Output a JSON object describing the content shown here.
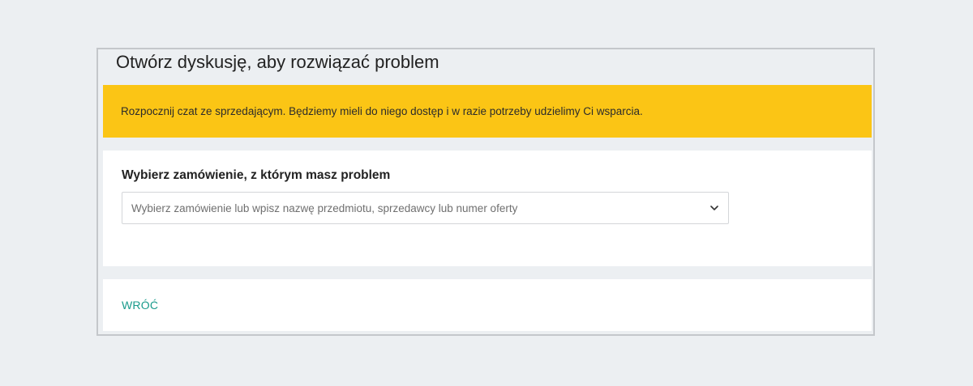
{
  "header": {
    "title": "Otwórz dyskusję, aby rozwiązać problem"
  },
  "banner": {
    "text": "Rozpocznij czat ze sprzedającym. Będziemy mieli do niego dostęp i w razie potrzeby udzielimy Ci wsparcia.",
    "background_color": "#fbc515"
  },
  "order_select": {
    "label": "Wybierz zamówienie, z którym masz problem",
    "placeholder": "Wybierz zamówienie lub wpisz nazwę przedmiotu, sprzedawcy lub numer oferty",
    "icon": "chevron-down-icon"
  },
  "footer": {
    "back_label": "WRÓĆ",
    "link_color": "#1a9b8c"
  }
}
